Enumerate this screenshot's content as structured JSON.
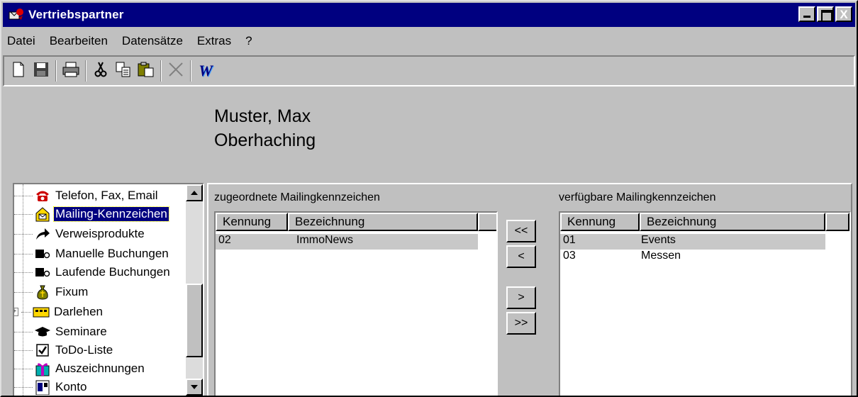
{
  "window": {
    "title": "Vertriebspartner",
    "controls": {
      "close_glyph": "X"
    }
  },
  "menu": {
    "items": [
      "Datei",
      "Bearbeiten",
      "Datensätze",
      "Extras",
      "?"
    ]
  },
  "toolbar": {
    "icons": [
      "new-icon",
      "save-icon",
      "print-icon",
      "cut-icon",
      "copy-icon",
      "paste-icon",
      "delete-icon",
      "word-icon"
    ],
    "word_glyph": "W"
  },
  "partner": {
    "name": "Muster, Max",
    "city": "Oberhaching"
  },
  "tree": {
    "items": [
      {
        "label": "Telefon, Fax, Email",
        "icon": "telephone-icon"
      },
      {
        "label": "Mailing-Kennzeichen",
        "icon": "mailbox-icon",
        "selected": true
      },
      {
        "label": "Verweisprodukte",
        "icon": "arrow-icon"
      },
      {
        "label": "Manuelle Buchungen",
        "icon": "booking-icon"
      },
      {
        "label": "Laufende Buchungen",
        "icon": "booking-icon"
      },
      {
        "label": "Fixum",
        "icon": "money-bag-icon"
      },
      {
        "label": "Darlehen",
        "icon": "loan-icon",
        "expander": "+"
      },
      {
        "label": "Seminare",
        "icon": "graduation-cap-icon"
      },
      {
        "label": "ToDo-Liste",
        "icon": "checkbox-icon"
      },
      {
        "label": "Auszeichnungen",
        "icon": "gift-icon"
      },
      {
        "label": "Konto",
        "icon": "account-icon"
      }
    ]
  },
  "assigned": {
    "title": "zugeordnete Mailingkennzeichen",
    "columns": [
      "Kennung",
      "Bezeichnung"
    ],
    "rows": [
      {
        "id": "02",
        "name": "ImmoNews"
      }
    ]
  },
  "available": {
    "title": "verfügbare Mailingkennzeichen",
    "columns": [
      "Kennung",
      "Bezeichnung"
    ],
    "rows": [
      {
        "id": "01",
        "name": "Events"
      },
      {
        "id": "03",
        "name": "Messen"
      }
    ]
  },
  "buttons": {
    "add_all": "<<",
    "add": "<",
    "remove": ">",
    "remove_all": ">>"
  },
  "colors": {
    "title_bar": "#000080",
    "face": "#c0c0c0",
    "selection": "#000080"
  }
}
